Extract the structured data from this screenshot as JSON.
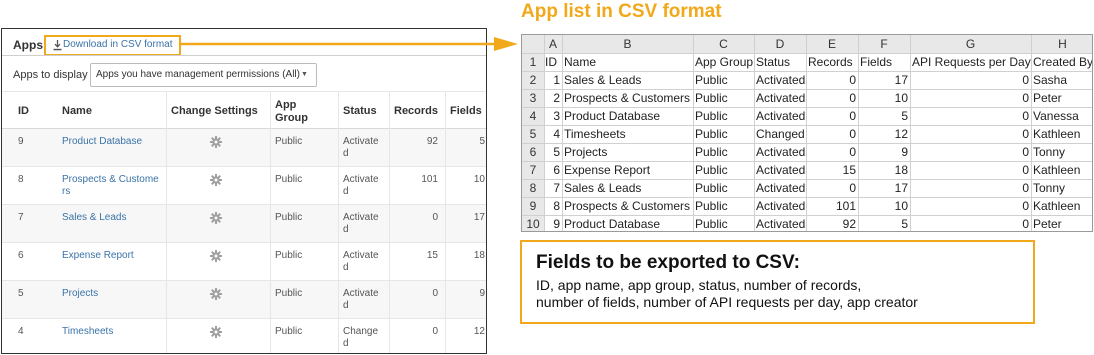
{
  "panel": {
    "title": "Apps",
    "download_link": "Download in CSV format",
    "display_label": "Apps to display",
    "display_select": "Apps you have management permissions (All)",
    "headers": {
      "id": "ID",
      "name": "Name",
      "change_settings": "Change Settings",
      "app_group_1": "App",
      "app_group_2": "Group",
      "status": "Status",
      "records": "Records",
      "fields": "Fields"
    },
    "rows": [
      {
        "id": "9",
        "name1": "Product Database",
        "name2": "",
        "group": "Public",
        "status1": "Activate",
        "status2": "d",
        "records": "92",
        "fields": "5"
      },
      {
        "id": "8",
        "name1": "Prospects & Custome",
        "name2": "rs",
        "group": "Public",
        "status1": "Activate",
        "status2": "d",
        "records": "101",
        "fields": "10"
      },
      {
        "id": "7",
        "name1": "Sales & Leads",
        "name2": "",
        "group": "Public",
        "status1": "Activate",
        "status2": "d",
        "records": "0",
        "fields": "17"
      },
      {
        "id": "6",
        "name1": "Expense Report",
        "name2": "",
        "group": "Public",
        "status1": "Activate",
        "status2": "d",
        "records": "15",
        "fields": "18"
      },
      {
        "id": "5",
        "name1": "Projects",
        "name2": "",
        "group": "Public",
        "status1": "Activate",
        "status2": "d",
        "records": "0",
        "fields": "9"
      },
      {
        "id": "4",
        "name1": "Timesheets",
        "name2": "",
        "group": "Public",
        "status1": "Change",
        "status2": "d",
        "records": "0",
        "fields": "12"
      }
    ]
  },
  "csv_title": "App list in CSV format",
  "sheet": {
    "corner": "",
    "columns": [
      "A",
      "B",
      "C",
      "D",
      "E",
      "F",
      "G",
      "H"
    ],
    "row_numbers": [
      "1",
      "2",
      "3",
      "4",
      "5",
      "6",
      "7",
      "8",
      "9",
      "10"
    ],
    "header_row": [
      "ID",
      "Name",
      "App Group",
      "Status",
      "Records",
      "Fields",
      "API Requests per Day",
      "Created By"
    ],
    "rows": [
      [
        "1",
        "Sales & Leads",
        "Public",
        "Activated",
        "0",
        "17",
        "0",
        "Sasha"
      ],
      [
        "2",
        "Prospects & Customers",
        "Public",
        "Activated",
        "0",
        "10",
        "0",
        "Peter"
      ],
      [
        "3",
        "Product Database",
        "Public",
        "Activated",
        "0",
        "5",
        "0",
        "Vanessa"
      ],
      [
        "4",
        "Timesheets",
        "Public",
        "Changed",
        "0",
        "12",
        "0",
        "Kathleen"
      ],
      [
        "5",
        "Projects",
        "Public",
        "Activated",
        "0",
        "9",
        "0",
        "Tonny"
      ],
      [
        "6",
        "Expense Report",
        "Public",
        "Activated",
        "15",
        "18",
        "0",
        "Kathleen"
      ],
      [
        "7",
        "Sales & Leads",
        "Public",
        "Activated",
        "0",
        "17",
        "0",
        "Tonny"
      ],
      [
        "8",
        "Prospects & Customers",
        "Public",
        "Activated",
        "101",
        "10",
        "0",
        "Kathleen"
      ],
      [
        "9",
        "Product Database",
        "Public",
        "Activated",
        "92",
        "5",
        "0",
        "Peter"
      ]
    ]
  },
  "fields_box": {
    "title": "Fields to be exported to CSV:",
    "line1": "ID, app name, app group, status, number of records,",
    "line2": "number of fields, number of API requests per day, app creator"
  },
  "colors": {
    "accent": "#f2a81b",
    "link": "#3a73a8",
    "gear": "#a0a0a0"
  },
  "icons": {
    "download": "download-icon",
    "gear": "gear-icon",
    "dropdown": "chevron-down-icon",
    "arrow": "arrow-right-icon"
  }
}
